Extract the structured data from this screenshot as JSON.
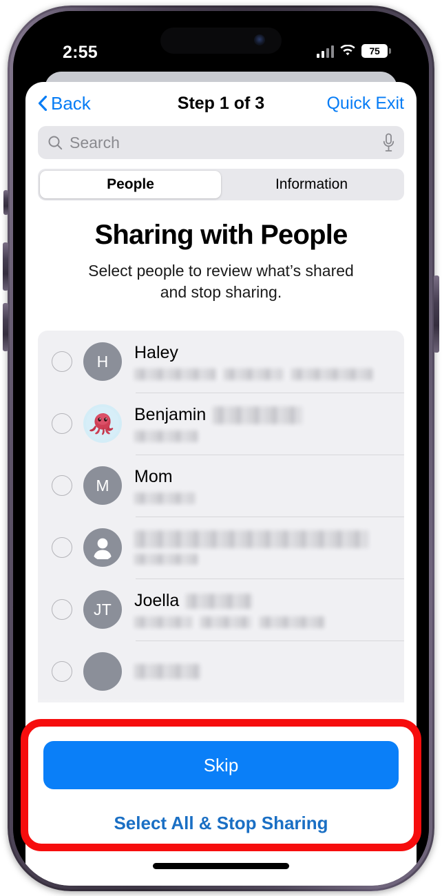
{
  "status_bar": {
    "time": "2:55",
    "battery_percent": "75",
    "icons": [
      "cellular-signal-icon",
      "wifi-icon",
      "battery-icon"
    ]
  },
  "nav": {
    "back_label": "Back",
    "title": "Step 1 of 3",
    "quick_exit_label": "Quick Exit",
    "accent_color": "#067cf5"
  },
  "search": {
    "placeholder": "Search",
    "icons": [
      "search-icon",
      "microphone-icon"
    ]
  },
  "segmented_control": {
    "options": [
      {
        "label": "People",
        "selected": true
      },
      {
        "label": "Information",
        "selected": false
      }
    ]
  },
  "header": {
    "title": "Sharing with People",
    "subtitle": "Select people to review what’s shared and stop sharing."
  },
  "people_list": {
    "rows": [
      {
        "name": "Haley",
        "avatar_type": "initials",
        "avatar_initials": "H",
        "avatar_color": "#8b8f99",
        "checked": false,
        "redacted_name_suffix": false,
        "redacted_detail_segments": 3
      },
      {
        "name": "Benjamin",
        "avatar_type": "memoji-octopus",
        "avatar_initials": "",
        "avatar_color": "#d4edf7",
        "checked": false,
        "redacted_name_suffix": true,
        "redacted_detail_segments": 1
      },
      {
        "name": "Mom",
        "avatar_type": "initials",
        "avatar_initials": "M",
        "avatar_color": "#8b8f99",
        "checked": false,
        "redacted_name_suffix": false,
        "redacted_detail_segments": 1
      },
      {
        "name": "",
        "avatar_type": "person-silhouette",
        "avatar_initials": "",
        "avatar_color": "#8b8f99",
        "checked": false,
        "name_fully_redacted": true,
        "redacted_detail_segments": 1
      },
      {
        "name": "Joella",
        "avatar_type": "initials",
        "avatar_initials": "JT",
        "avatar_color": "#8b8f99",
        "checked": false,
        "redacted_name_suffix": true,
        "redacted_detail_segments": 3
      }
    ]
  },
  "bottom_actions": {
    "primary_label": "Skip",
    "primary_color": "#0a7ff8",
    "secondary_label": "Select All & Stop Sharing",
    "secondary_color": "#1a6fc4"
  },
  "annotation": {
    "color": "#f60d0d",
    "shape": "rounded-rectangle-highlight"
  }
}
